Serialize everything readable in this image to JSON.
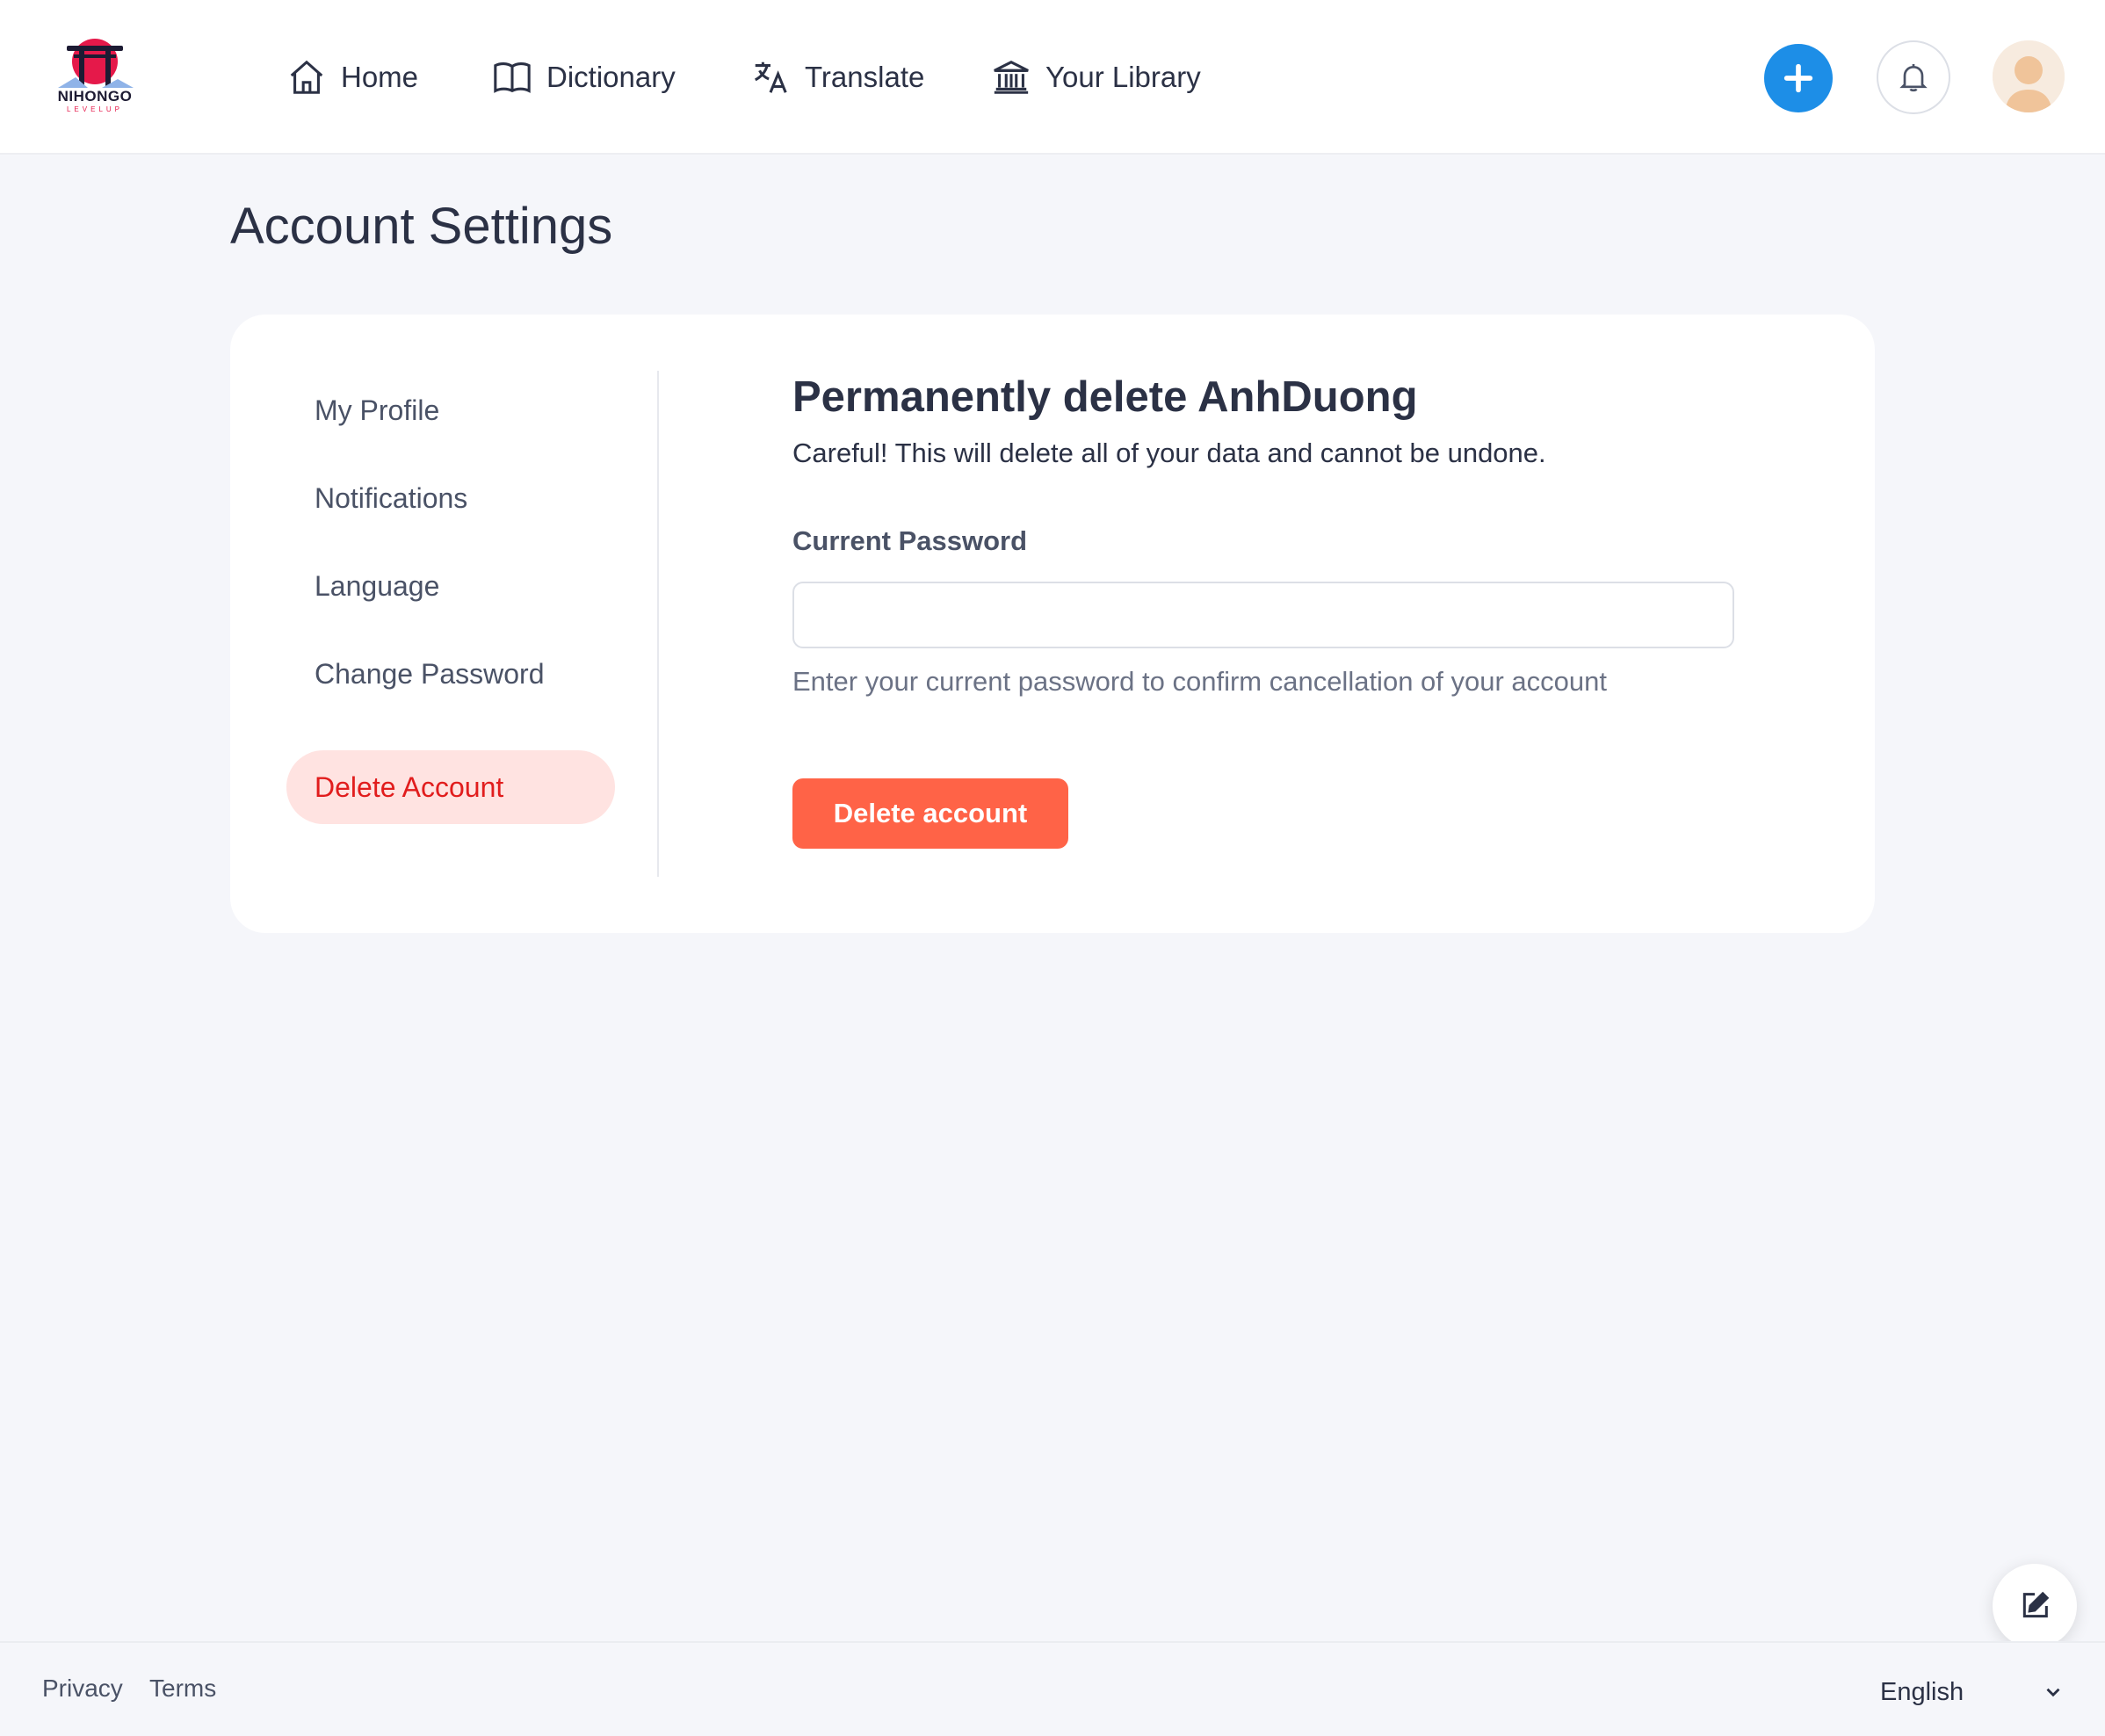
{
  "brand": {
    "name": "NIHONGO",
    "tagline": "LEVELUP"
  },
  "nav": {
    "home": "Home",
    "dictionary": "Dictionary",
    "translate": "Translate",
    "library": "Your Library"
  },
  "header_icons": [
    "plus-icon",
    "bell-icon",
    "user-avatar"
  ],
  "page": {
    "title": "Account Settings"
  },
  "sidebar": {
    "items": [
      {
        "label": "My Profile"
      },
      {
        "label": "Notifications"
      },
      {
        "label": "Language"
      },
      {
        "label": "Change Password"
      },
      {
        "label": "Delete Account",
        "active": true
      }
    ]
  },
  "delete_section": {
    "title": "Permanently delete AnhDuong",
    "description": "Careful! This will delete all of your data and cannot be undone.",
    "field_label": "Current Password",
    "field_value": "",
    "help_text": "Enter your current password to confirm cancellation of your account",
    "button_label": "Delete account"
  },
  "footer": {
    "privacy": "Privacy",
    "terms": "Terms",
    "language": "English"
  },
  "colors": {
    "accent_blue": "#1d8ee7",
    "danger": "#ff6347",
    "danger_text": "#e11d1d",
    "active_bg": "#ffe3e1"
  }
}
